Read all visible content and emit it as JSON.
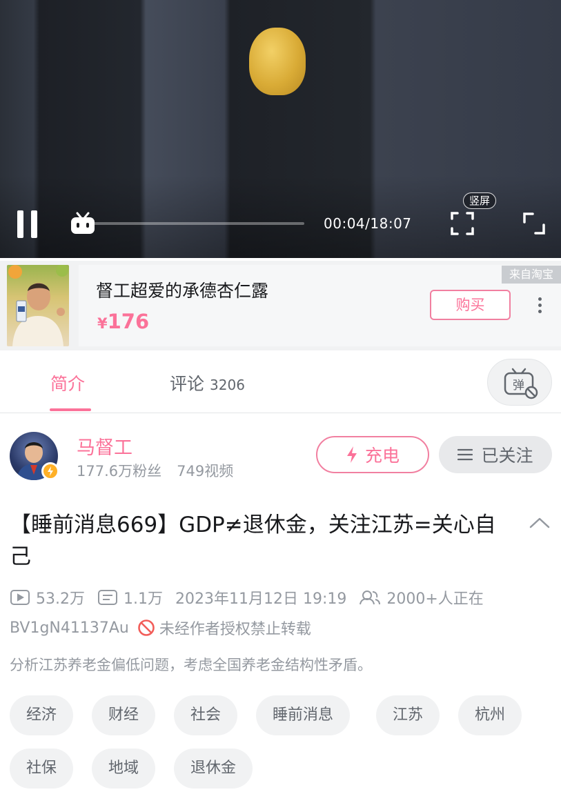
{
  "player": {
    "current_time": "00:04",
    "duration": "18:07",
    "time_text": "00:04/18:07",
    "progress_fraction": 0.004,
    "vertical_label": "竖屏",
    "accent_color": "#fb7299"
  },
  "ad": {
    "title": "督工超爱的承德杏仁露",
    "price_symbol": "¥",
    "price_value": "176",
    "buy_label": "购买",
    "source_tag": "来自淘宝"
  },
  "tabs": {
    "intro_label": "简介",
    "comments_label": "评论",
    "comments_count": "3206"
  },
  "uploader": {
    "name": "马督工",
    "fans": "177.6万粉丝",
    "videos": "749视频",
    "charge_label": "充电",
    "follow_label": "已关注"
  },
  "video": {
    "title": "【睡前消息669】GDP≠退休金，关注江苏=关心自己",
    "views": "53.2万",
    "danmaku": "1.1万",
    "date": "2023年11月12日 19:19",
    "watching": "2000+人正在",
    "bvid": "BV1gN41137Au",
    "copyright_notice": "未经作者授权禁止转载",
    "description": "分析江苏养老金偏低问题，考虑全国养老金结构性矛盾。"
  },
  "tags": [
    "经济",
    "财经",
    "社会",
    "睡前消息",
    "江苏",
    "杭州",
    "社保",
    "地域",
    "退休金"
  ]
}
